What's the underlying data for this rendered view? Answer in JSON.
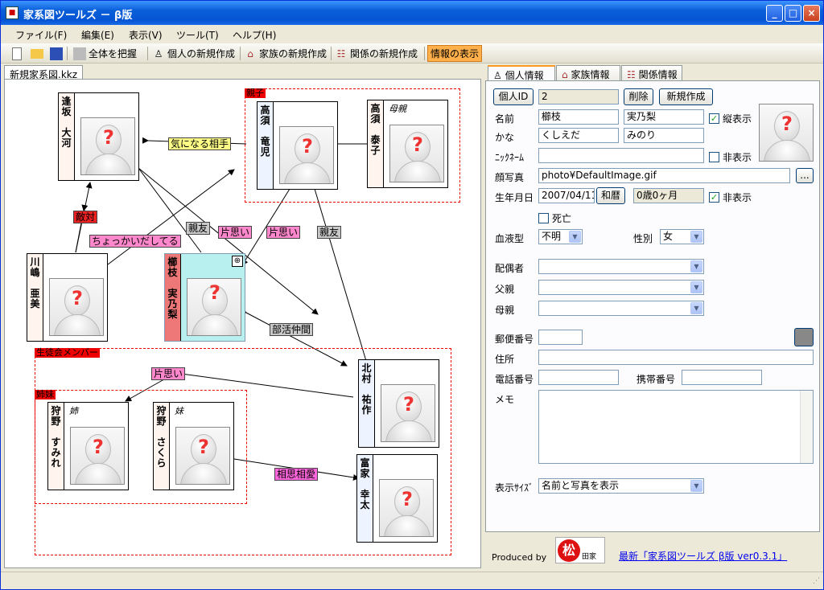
{
  "window": {
    "title": "家系図ツールズ － β版",
    "min": "_",
    "max": "□",
    "close": "×"
  },
  "menu": [
    "ファイル(F)",
    "編集(E)",
    "表示(V)",
    "ツール(T)",
    "ヘルプ(H)"
  ],
  "toolbar": {
    "overview": "全体を把握",
    "new_person": "個人の新規作成",
    "new_family": "家族の新規作成",
    "new_relation": "関係の新規作成",
    "show_info": "情報の表示"
  },
  "doc_tab": "新規家系図.kkz",
  "groups": {
    "parents": "親子",
    "council": "生徒会メンバー",
    "sisters": "姉妹"
  },
  "people": {
    "aisaka": {
      "family": "逢坂",
      "given": "大河",
      "title": ""
    },
    "takasu_r": {
      "family": "高須",
      "given": "竜児",
      "title": ""
    },
    "takasu_y": {
      "family": "高須",
      "given": "泰子",
      "title": "母親"
    },
    "kawashima": {
      "family": "川嶋",
      "given": "亜美",
      "title": ""
    },
    "kushieda": {
      "family": "櫛枝",
      "given": "実乃梨",
      "title": ""
    },
    "kitamura": {
      "family": "北村",
      "given": "祐作",
      "title": ""
    },
    "kano_s": {
      "family": "狩野",
      "given": "すみれ",
      "title": "姉"
    },
    "kano_sa": {
      "family": "狩野",
      "given": "さくら",
      "title": "妹"
    },
    "tomiie": {
      "family": "富家",
      "given": "幸太",
      "title": ""
    }
  },
  "relations": {
    "kininaru": "気になる相手",
    "tekitai": "敵対",
    "chokkai": "ちょっかいだしてる",
    "shinyu1": "親友",
    "kataomoi1": "片思い",
    "kataomoi2": "片思い",
    "shinyu2": "親友",
    "bukatsu": "部活仲間",
    "kataomoi3": "片思い",
    "soshiso": "相思相愛"
  },
  "icons": {
    "move": "⊕",
    "question": "?"
  },
  "tabs": {
    "personal": "個人情報",
    "family": "家族情報",
    "relation": "関係情報"
  },
  "form": {
    "id_button": "個人ID",
    "id_value": "2",
    "delete_button": "削除",
    "new_button": "新規作成",
    "name_label": "名前",
    "family_name": "櫛枝",
    "given_name": "実乃梨",
    "vertical_label": "縦表示",
    "kana_label": "かな",
    "family_kana": "くしえだ",
    "given_kana": "みのり",
    "nickname_label": "ﾆｯｸﾈｰﾑ",
    "nickname_value": "",
    "hide_label": "非表示",
    "photo_label": "顔写真",
    "photo_value": "photo¥DefaultImage.gif",
    "browse_button": "...",
    "birth_label": "生年月日",
    "birth_value": "2007/04/11",
    "wareki_button": "和暦",
    "age_value": "0歳0ヶ月",
    "birth_hide_label": "非表示",
    "dead_label": "死亡",
    "blood_label": "血液型",
    "blood_value": "不明",
    "sex_label": "性別",
    "sex_value": "女",
    "spouse_label": "配偶者",
    "father_label": "父親",
    "mother_label": "母親",
    "postal_label": "郵便番号",
    "address_label": "住所",
    "phone_label": "電話番号",
    "mobile_label": "携帯番号",
    "memo_label": "メモ",
    "display_size_label": "表示ｻｲｽﾞ",
    "display_size_value": "名前と写真を表示"
  },
  "footer": {
    "produced_by": "Produced by",
    "logo_text": "松",
    "logo_sub": "田家",
    "latest_link": "最新「家系図ツールズ β版 ver0.3.1」"
  }
}
